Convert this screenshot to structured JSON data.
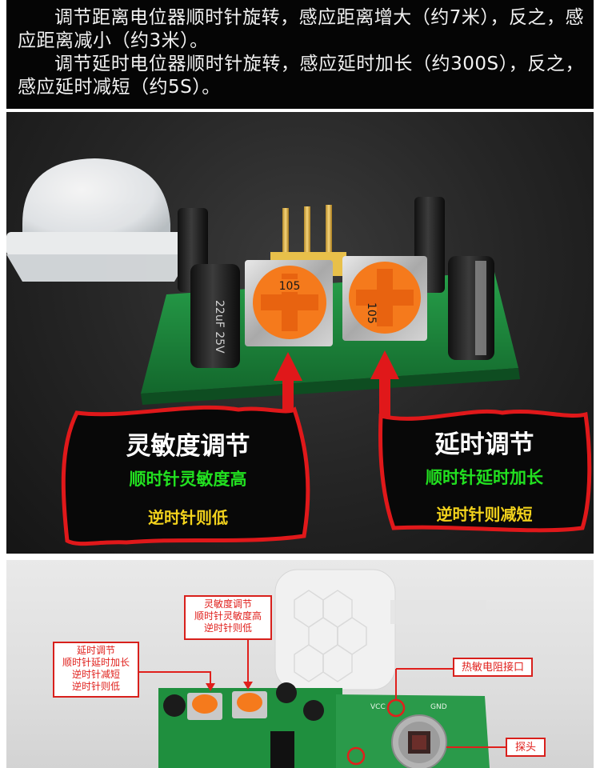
{
  "intro": {
    "line1": "调节距离电位器顺时针旋转，感应距离增大（约7米），反之，感应距离减小（约3米）。",
    "line2": "调节延时电位器顺时针旋转，感应延时加长（约300S），反之，感应延时减短（约5S）。"
  },
  "photo1": {
    "left_pot_marking": "105",
    "right_pot_marking": "105",
    "left_callout": {
      "title": "灵敏度调节",
      "green": "顺时针灵敏度高",
      "yellow": "逆时针则低"
    },
    "right_callout": {
      "title": "延时调节",
      "green": "顺时针延时加长",
      "yellow": "逆时针则减短"
    }
  },
  "photo2": {
    "sensitivity_label": [
      "灵敏度调节",
      "顺时针灵敏度高",
      "逆时针则低"
    ],
    "delay_label": [
      "延时调节",
      "顺时针延时加长",
      "逆时针减短",
      "逆时针则低"
    ],
    "thermistor_label": "热敏电阻接口",
    "probe_label": "探头"
  },
  "colors": {
    "callout_border": "#e0181a",
    "callout_green": "#22e020",
    "callout_yellow": "#f2d21c",
    "pcb_green": "#1f8f3e",
    "pot_orange": "#f57a1c",
    "label_red": "#e0201c"
  }
}
